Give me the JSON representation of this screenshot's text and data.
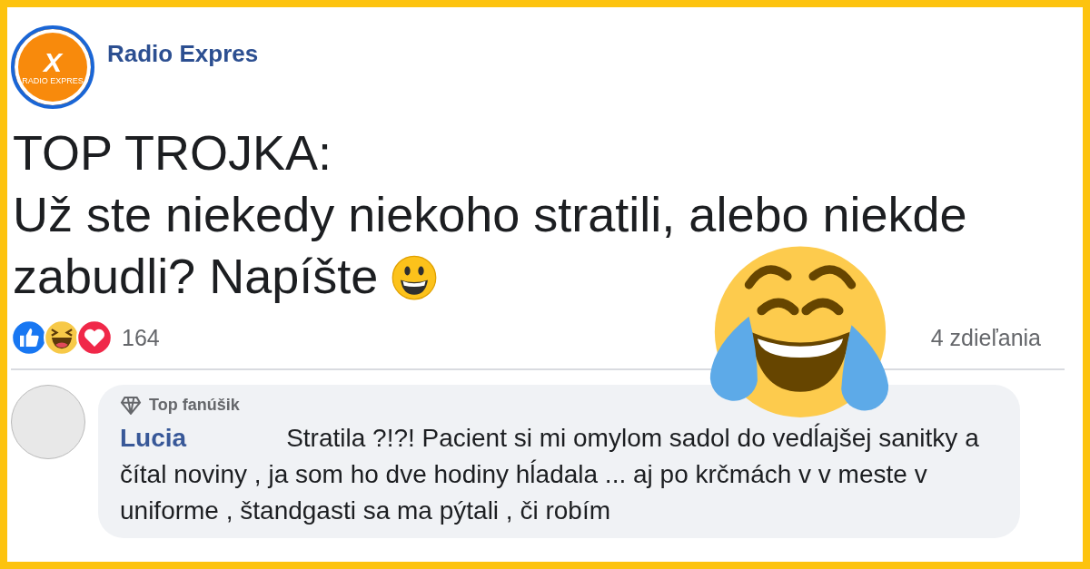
{
  "page": {
    "name": "Radio Expres",
    "logo_text": "RADIO EXPRES",
    "logo_letter": "X"
  },
  "post": {
    "title": "TOP TROJKA:",
    "body": "Už ste niekedy niekoho stratili, alebo niekde zabudli? Napíšte"
  },
  "reactions": {
    "count": "164",
    "shares": "4 zdieľania"
  },
  "comment": {
    "badge": "Top fanúšik",
    "author": "Lucia",
    "text": "Stratila ?!?! Pacient si mi omylom sadol do vedĺajšej sanitky a čítal noviny , ja som ho dve hodiny hĺadala ... aj po krčmách v v meste v uniforme , štandgasti sa ma pýtali , či robím"
  }
}
